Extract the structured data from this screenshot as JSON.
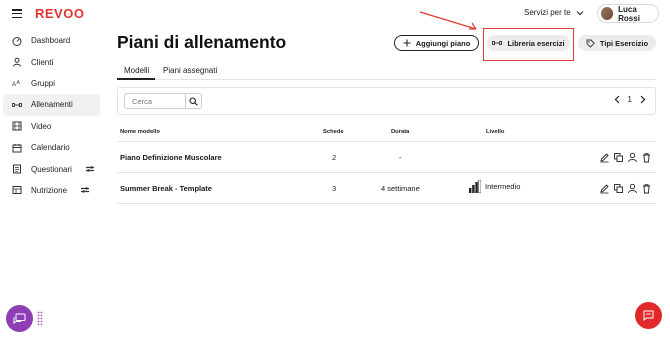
{
  "header": {
    "logo": "REVOO",
    "services_label": "Servizi per te",
    "user_name": "Luca Rossi"
  },
  "sidebar": {
    "items": [
      {
        "label": "Dashboard",
        "icon": "dashboard-icon"
      },
      {
        "label": "Clienti",
        "icon": "user-icon"
      },
      {
        "label": "Gruppi",
        "icon": "group-icon"
      },
      {
        "label": "Allenamenti",
        "icon": "dumbbell-icon",
        "active": true
      },
      {
        "label": "Video",
        "icon": "video-icon"
      },
      {
        "label": "Calendario",
        "icon": "calendar-icon"
      },
      {
        "label": "Questionari",
        "icon": "document-icon",
        "extra": "toggle-icon"
      },
      {
        "label": "Nutrizione",
        "icon": "food-icon",
        "extra": "toggle-icon"
      }
    ]
  },
  "main": {
    "title": "Piani di allenamento",
    "buttons": {
      "add_plan": "Aggiungi piano",
      "exercise_library": "Libreria esercizi",
      "exercise_types": "Tipi Esercizio"
    },
    "tabs": [
      "Modelli",
      "Piani assegnati"
    ],
    "search": {
      "placeholder": "Cerca"
    },
    "pager": {
      "page": "1"
    },
    "table": {
      "columns": [
        "Nome modello",
        "Schede",
        "Durata",
        "Livello"
      ],
      "rows": [
        {
          "name": "Piano Definizione Muscolare",
          "schede": "2",
          "durata": "-",
          "livello": ""
        },
        {
          "name": "Summer Break - Template",
          "schede": "3",
          "durata": "4 settimane",
          "livello": "Intermedio"
        }
      ]
    }
  },
  "colors": {
    "brand": "#e3342f",
    "highlight": "#e03a32",
    "chat_left": "#8e3fb5",
    "chat_right": "#e02a2a"
  }
}
